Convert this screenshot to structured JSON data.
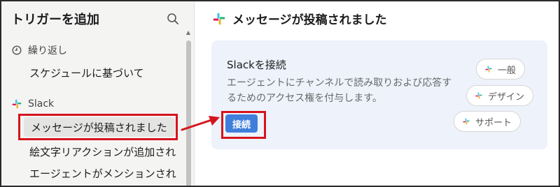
{
  "sidebar": {
    "title": "トリガーを追加",
    "sections": {
      "recurring": {
        "label": "繰り返し",
        "items": [
          "スケジュールに基づいて"
        ]
      },
      "slack": {
        "label": "Slack",
        "items": [
          "メッセージが投稿されました",
          "絵文字リアクションが追加され",
          "エージェントがメンションされ"
        ]
      }
    }
  },
  "main": {
    "title": "メッセージが投稿されました",
    "card": {
      "title": "Slackを接続",
      "description": "エージェントにチャンネルで読み取りおよび応答するためのアクセス権を付与します。",
      "connect_label": "接続",
      "channels": [
        "一般",
        "デザイン",
        "サポート"
      ]
    }
  },
  "colors": {
    "accent": "#3f7fdb",
    "annotation": "#d6141c",
    "card_bg": "#edf2fb"
  },
  "icons": [
    "search-icon",
    "clock-icon",
    "slack-logo-icon"
  ]
}
